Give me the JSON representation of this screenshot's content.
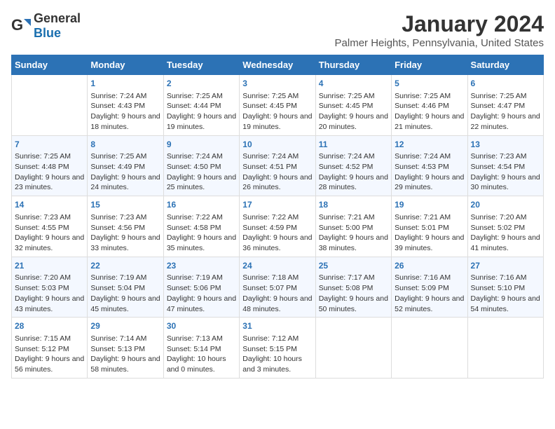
{
  "header": {
    "logo": {
      "general": "General",
      "blue": "Blue"
    },
    "title": "January 2024",
    "subtitle": "Palmer Heights, Pennsylvania, United States"
  },
  "weekdays": [
    "Sunday",
    "Monday",
    "Tuesday",
    "Wednesday",
    "Thursday",
    "Friday",
    "Saturday"
  ],
  "weeks": [
    [
      {
        "day": "",
        "sunrise": "",
        "sunset": "",
        "daylight": ""
      },
      {
        "day": "1",
        "sunrise": "Sunrise: 7:24 AM",
        "sunset": "Sunset: 4:43 PM",
        "daylight": "Daylight: 9 hours and 18 minutes."
      },
      {
        "day": "2",
        "sunrise": "Sunrise: 7:25 AM",
        "sunset": "Sunset: 4:44 PM",
        "daylight": "Daylight: 9 hours and 19 minutes."
      },
      {
        "day": "3",
        "sunrise": "Sunrise: 7:25 AM",
        "sunset": "Sunset: 4:45 PM",
        "daylight": "Daylight: 9 hours and 19 minutes."
      },
      {
        "day": "4",
        "sunrise": "Sunrise: 7:25 AM",
        "sunset": "Sunset: 4:45 PM",
        "daylight": "Daylight: 9 hours and 20 minutes."
      },
      {
        "day": "5",
        "sunrise": "Sunrise: 7:25 AM",
        "sunset": "Sunset: 4:46 PM",
        "daylight": "Daylight: 9 hours and 21 minutes."
      },
      {
        "day": "6",
        "sunrise": "Sunrise: 7:25 AM",
        "sunset": "Sunset: 4:47 PM",
        "daylight": "Daylight: 9 hours and 22 minutes."
      }
    ],
    [
      {
        "day": "7",
        "sunrise": "Sunrise: 7:25 AM",
        "sunset": "Sunset: 4:48 PM",
        "daylight": "Daylight: 9 hours and 23 minutes."
      },
      {
        "day": "8",
        "sunrise": "Sunrise: 7:25 AM",
        "sunset": "Sunset: 4:49 PM",
        "daylight": "Daylight: 9 hours and 24 minutes."
      },
      {
        "day": "9",
        "sunrise": "Sunrise: 7:24 AM",
        "sunset": "Sunset: 4:50 PM",
        "daylight": "Daylight: 9 hours and 25 minutes."
      },
      {
        "day": "10",
        "sunrise": "Sunrise: 7:24 AM",
        "sunset": "Sunset: 4:51 PM",
        "daylight": "Daylight: 9 hours and 26 minutes."
      },
      {
        "day": "11",
        "sunrise": "Sunrise: 7:24 AM",
        "sunset": "Sunset: 4:52 PM",
        "daylight": "Daylight: 9 hours and 28 minutes."
      },
      {
        "day": "12",
        "sunrise": "Sunrise: 7:24 AM",
        "sunset": "Sunset: 4:53 PM",
        "daylight": "Daylight: 9 hours and 29 minutes."
      },
      {
        "day": "13",
        "sunrise": "Sunrise: 7:23 AM",
        "sunset": "Sunset: 4:54 PM",
        "daylight": "Daylight: 9 hours and 30 minutes."
      }
    ],
    [
      {
        "day": "14",
        "sunrise": "Sunrise: 7:23 AM",
        "sunset": "Sunset: 4:55 PM",
        "daylight": "Daylight: 9 hours and 32 minutes."
      },
      {
        "day": "15",
        "sunrise": "Sunrise: 7:23 AM",
        "sunset": "Sunset: 4:56 PM",
        "daylight": "Daylight: 9 hours and 33 minutes."
      },
      {
        "day": "16",
        "sunrise": "Sunrise: 7:22 AM",
        "sunset": "Sunset: 4:58 PM",
        "daylight": "Daylight: 9 hours and 35 minutes."
      },
      {
        "day": "17",
        "sunrise": "Sunrise: 7:22 AM",
        "sunset": "Sunset: 4:59 PM",
        "daylight": "Daylight: 9 hours and 36 minutes."
      },
      {
        "day": "18",
        "sunrise": "Sunrise: 7:21 AM",
        "sunset": "Sunset: 5:00 PM",
        "daylight": "Daylight: 9 hours and 38 minutes."
      },
      {
        "day": "19",
        "sunrise": "Sunrise: 7:21 AM",
        "sunset": "Sunset: 5:01 PM",
        "daylight": "Daylight: 9 hours and 39 minutes."
      },
      {
        "day": "20",
        "sunrise": "Sunrise: 7:20 AM",
        "sunset": "Sunset: 5:02 PM",
        "daylight": "Daylight: 9 hours and 41 minutes."
      }
    ],
    [
      {
        "day": "21",
        "sunrise": "Sunrise: 7:20 AM",
        "sunset": "Sunset: 5:03 PM",
        "daylight": "Daylight: 9 hours and 43 minutes."
      },
      {
        "day": "22",
        "sunrise": "Sunrise: 7:19 AM",
        "sunset": "Sunset: 5:04 PM",
        "daylight": "Daylight: 9 hours and 45 minutes."
      },
      {
        "day": "23",
        "sunrise": "Sunrise: 7:19 AM",
        "sunset": "Sunset: 5:06 PM",
        "daylight": "Daylight: 9 hours and 47 minutes."
      },
      {
        "day": "24",
        "sunrise": "Sunrise: 7:18 AM",
        "sunset": "Sunset: 5:07 PM",
        "daylight": "Daylight: 9 hours and 48 minutes."
      },
      {
        "day": "25",
        "sunrise": "Sunrise: 7:17 AM",
        "sunset": "Sunset: 5:08 PM",
        "daylight": "Daylight: 9 hours and 50 minutes."
      },
      {
        "day": "26",
        "sunrise": "Sunrise: 7:16 AM",
        "sunset": "Sunset: 5:09 PM",
        "daylight": "Daylight: 9 hours and 52 minutes."
      },
      {
        "day": "27",
        "sunrise": "Sunrise: 7:16 AM",
        "sunset": "Sunset: 5:10 PM",
        "daylight": "Daylight: 9 hours and 54 minutes."
      }
    ],
    [
      {
        "day": "28",
        "sunrise": "Sunrise: 7:15 AM",
        "sunset": "Sunset: 5:12 PM",
        "daylight": "Daylight: 9 hours and 56 minutes."
      },
      {
        "day": "29",
        "sunrise": "Sunrise: 7:14 AM",
        "sunset": "Sunset: 5:13 PM",
        "daylight": "Daylight: 9 hours and 58 minutes."
      },
      {
        "day": "30",
        "sunrise": "Sunrise: 7:13 AM",
        "sunset": "Sunset: 5:14 PM",
        "daylight": "Daylight: 10 hours and 0 minutes."
      },
      {
        "day": "31",
        "sunrise": "Sunrise: 7:12 AM",
        "sunset": "Sunset: 5:15 PM",
        "daylight": "Daylight: 10 hours and 3 minutes."
      },
      {
        "day": "",
        "sunrise": "",
        "sunset": "",
        "daylight": ""
      },
      {
        "day": "",
        "sunrise": "",
        "sunset": "",
        "daylight": ""
      },
      {
        "day": "",
        "sunrise": "",
        "sunset": "",
        "daylight": ""
      }
    ]
  ]
}
